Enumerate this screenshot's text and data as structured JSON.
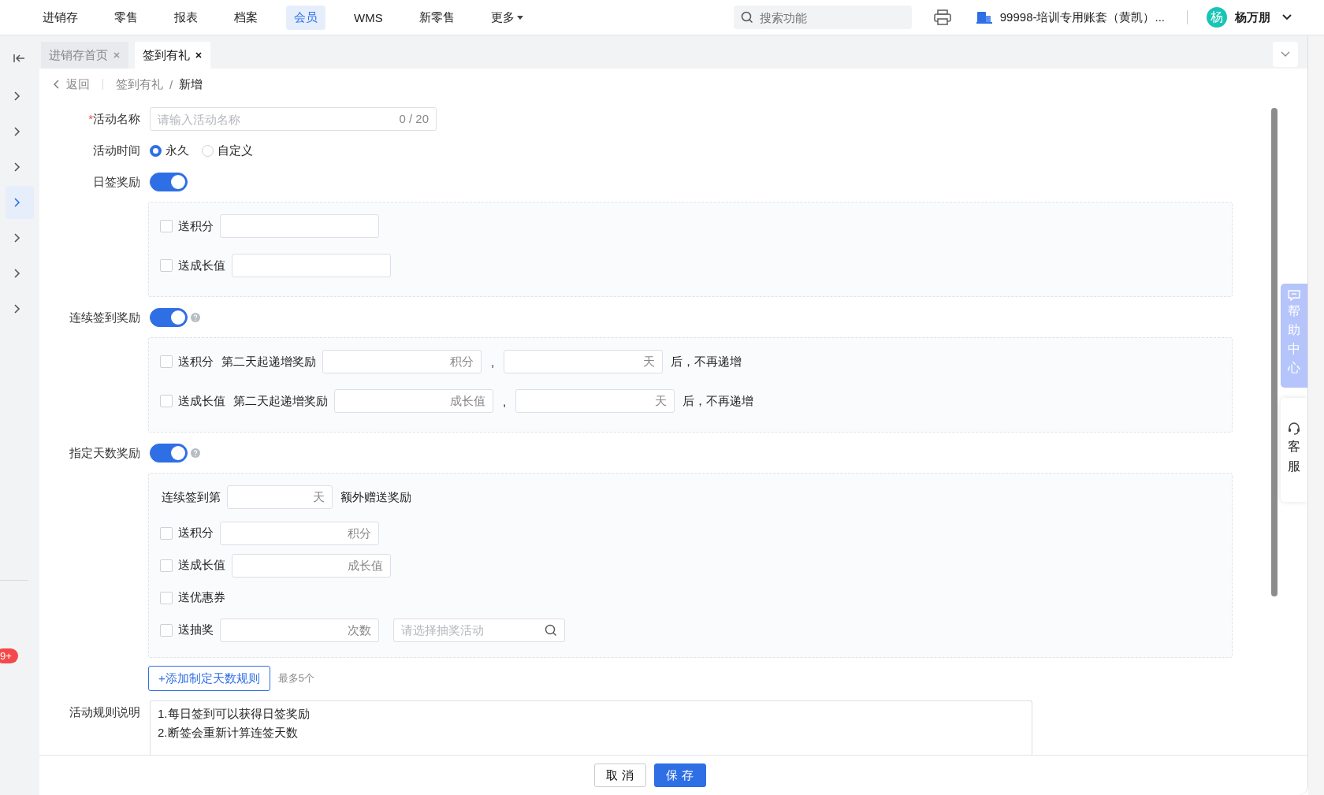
{
  "nav": {
    "items": [
      {
        "label": "进销存",
        "selected": false
      },
      {
        "label": "零售",
        "selected": false
      },
      {
        "label": "报表",
        "selected": false
      },
      {
        "label": "档案",
        "selected": false
      },
      {
        "label": "会员",
        "selected": true
      },
      {
        "label": "WMS",
        "selected": false
      },
      {
        "label": "新零售",
        "selected": false
      }
    ],
    "more": "更多",
    "search_placeholder": "搜索功能",
    "account": "99998-培训专用账套（黄凯）...",
    "avatar": "杨",
    "user": "杨万朋"
  },
  "sidebar": {
    "items": [
      {
        "selected": false
      },
      {
        "selected": false
      },
      {
        "selected": false
      },
      {
        "selected": true
      },
      {
        "selected": false
      },
      {
        "selected": false
      },
      {
        "selected": false
      }
    ],
    "badge": "9+"
  },
  "tabs": [
    {
      "label": "进销存首页",
      "selected": false
    },
    {
      "label": "签到有礼",
      "selected": true
    }
  ],
  "breadcrumb": {
    "back": "返回",
    "separator": "/",
    "items": [
      "签到有礼",
      "新增"
    ]
  },
  "form": {
    "name": {
      "label": "活动名称",
      "required_mark": "*",
      "placeholder": "请输入活动名称",
      "counter": "0 / 20"
    },
    "time": {
      "label": "活动时间",
      "options": [
        {
          "label": "永久",
          "selected": true
        },
        {
          "label": "自定义",
          "selected": false
        }
      ]
    },
    "daily": {
      "label": "日签奖励",
      "on": true,
      "rows": [
        {
          "label": "送积分",
          "checked": false
        },
        {
          "label": "送成长值",
          "checked": false
        }
      ]
    },
    "continuous": {
      "label": "连续签到奖励",
      "on": true,
      "help": true,
      "rows": [
        {
          "label": "送积分",
          "checked": false,
          "prefix": "第二天起递增奖励",
          "unit": "积分",
          "separator": ",",
          "day_unit": "天",
          "suffix": "后，不再递增"
        },
        {
          "label": "送成长值",
          "checked": false,
          "prefix": "第二天起递增奖励",
          "unit": "成长值",
          "separator": ",",
          "day_unit": "天",
          "suffix": "后，不再递增"
        }
      ]
    },
    "designated": {
      "label": "指定天数奖励",
      "on": true,
      "help": true,
      "day_prefix": "连续签到第",
      "day_unit": "天",
      "day_suffix": "额外赠送奖励",
      "rows": [
        {
          "kind": "input",
          "label": "送积分",
          "checked": false,
          "unit": "积分"
        },
        {
          "kind": "input",
          "label": "送成长值",
          "checked": false,
          "unit": "成长值"
        },
        {
          "kind": "plain",
          "label": "送优惠券",
          "checked": false
        },
        {
          "kind": "lottery",
          "label": "送抽奖",
          "checked": false,
          "unit": "次数",
          "placeholder": "请选择抽奖活动"
        }
      ]
    },
    "add_button": "+添加制定天数规则",
    "add_note": "最多5个",
    "rules": {
      "label": "活动规则说明",
      "lines": [
        "1.每日签到可以获得日签奖励",
        "2.断签会重新计算连签天数"
      ]
    }
  },
  "footer": {
    "buttons": [
      {
        "label": "取 消",
        "kind": "default"
      },
      {
        "label": "保 存",
        "kind": "primary"
      }
    ]
  },
  "widgets": {
    "help": "帮助中心",
    "service": "客服"
  }
}
